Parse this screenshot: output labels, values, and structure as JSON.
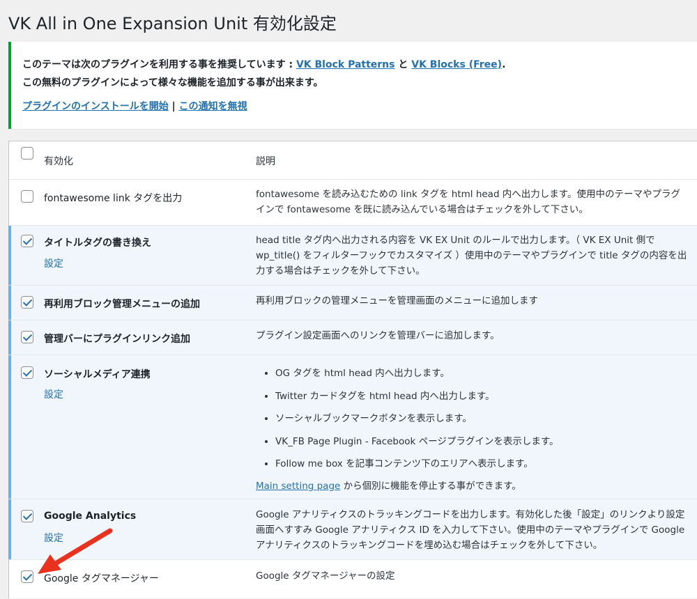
{
  "page_title": "VK All in One Expansion Unit 有効化設定",
  "notice": {
    "line1_pre": "このテーマは次のプラグインを利用する事を推奨しています : ",
    "plugin1": "VK Block Patterns",
    "and": " と ",
    "plugin2": "VK Blocks (Free)",
    "line1_post": ".",
    "line2": "この無料のプラグインによって様々な機能を追加する事が出来ます。",
    "install_link": "プラグインのインストールを開始",
    "separator": " | ",
    "dismiss_link": "この通知を無視"
  },
  "table": {
    "headers": {
      "enable": "有効化",
      "description": "説明"
    },
    "rows": [
      {
        "name": "fontawesome link タグを出力",
        "checked": false,
        "desc": "fontawesome を読み込むための link タグを html head 内へ出力します。使用中のテーマやプラグインで fontawesome を既に読み込んでいる場合はチェックを外して下さい。"
      },
      {
        "name": "タイトルタグの書き換え",
        "checked": true,
        "setting": "設定",
        "desc": "head title タグ内へ出力される内容を VK EX Unit のルールで出力します。（ VK EX Unit 側で wp_title() をフィルターフックでカスタマイズ ）使用中のテーマやプラグインで title タグの内容を出力する場合はチェックを外して下さい。"
      },
      {
        "name": "再利用ブロック管理メニューの追加",
        "checked": true,
        "desc": "再利用ブロックの管理メニューを管理画面のメニューに追加します"
      },
      {
        "name": "管理バーにプラグインリンク追加",
        "checked": true,
        "desc": "プラグイン設定画面へのリンクを管理バーに追加します。"
      },
      {
        "name": "ソーシャルメディア連携",
        "checked": true,
        "setting": "設定",
        "bullets": [
          "OG タグを html head 内へ出力します。",
          "Twitter カードタグを html head 内へ出力します。",
          "ソーシャルブックマークボタンを表示します。",
          "VK_FB Page Plugin - Facebook ページプラグインを表示します。",
          "Follow me box を記事コンテンツ下のエリアへ表示します。"
        ],
        "main_link": "Main setting page",
        "main_link_post": " から個別に機能を停止する事ができます。"
      },
      {
        "name": "Google Analytics",
        "checked": true,
        "setting": "設定",
        "desc": "Google アナリティクスのトラッキングコードを出力します。有効化した後「設定」のリンクより設定画面へすすみ Google アナリティクス ID を入力して下さい。使用中のテーマやプラグインで Google アナリティクスのトラッキングコードを埋め込む場合はチェックを外して下さい。"
      },
      {
        "name": "Google タグマネージャー",
        "checked": true,
        "desc": "Google タグマネージャーの設定"
      }
    ]
  },
  "colors": {
    "accent": "#2271b1",
    "notice_border": "#00a32a",
    "active_row": "#f0f6fc",
    "arrow": "#e8321e"
  }
}
